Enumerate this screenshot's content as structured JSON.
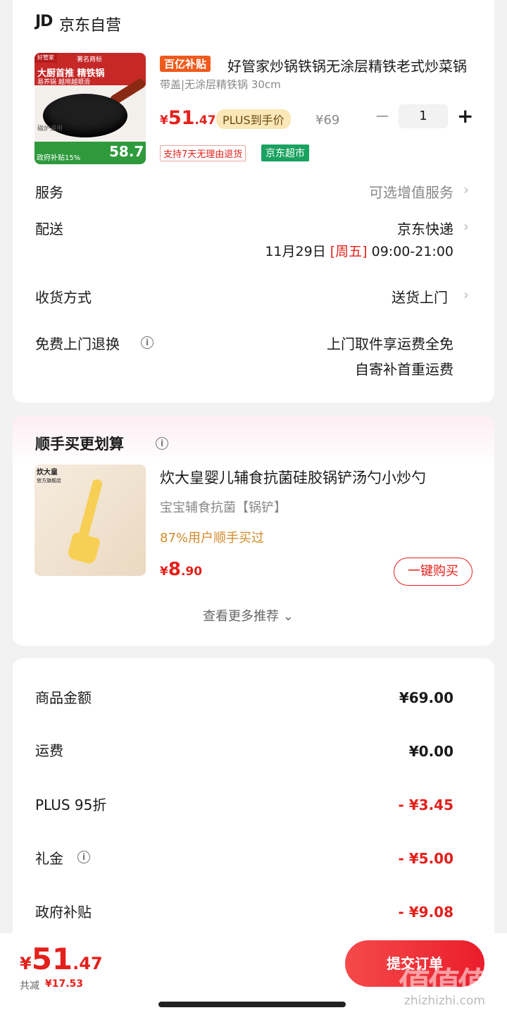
{
  "shop": {
    "logo": "JD",
    "name": "京东自营"
  },
  "product": {
    "badge": "百亿补贴",
    "title": "好管家炒锅铁锅无涂层精铁老式炒菜锅",
    "spec": "带盖|无涂层精铁锅 30cm",
    "price_symbol": "¥",
    "price_int": "51",
    "price_dec": ".47",
    "plus_tag": "PLUS到手价",
    "original_price": "¥69",
    "quantity": "1",
    "return_tag": "支持7天无理由退货",
    "supermarket_tag": "京东超市",
    "image": {
      "brand": "好管家",
      "trademark": "著名商标",
      "banner": "大厨首推 精铁锅",
      "tagline": "易养锅 越用越顺滑",
      "stove": "磁炉通用",
      "gov_subsidy": "政府补贴15%",
      "price": "58.7"
    }
  },
  "rows": {
    "service": {
      "label": "服务",
      "value": "可选增值服务"
    },
    "delivery": {
      "label": "配送",
      "value": "京东快递",
      "date": "11月29日",
      "weekday": "[周五]",
      "time": "09:00-21:00"
    },
    "receive": {
      "label": "收货方式",
      "value": "送货上门"
    },
    "return": {
      "label": "免费上门退换",
      "line1": "上门取件享运费全免",
      "line2": "自寄补首重运费"
    }
  },
  "recommend": {
    "title": "顺手买更划算",
    "item_name": "炊大皇婴儿辅食抗菌硅胶锅铲汤勺小炒勺",
    "item_sub": "宝宝辅食抗菌【锅铲】",
    "item_stat": "87%用户顺手买过",
    "price_symbol": "¥",
    "price_int": "8",
    "price_dec": ".90",
    "buy_button": "一键购买",
    "more": "查看更多推荐",
    "image_brand": "炊大皇",
    "image_store": "官方旗舰店"
  },
  "fees": [
    {
      "label": "商品金额",
      "value": "¥69.00",
      "negative": false
    },
    {
      "label": "运费",
      "value": "¥0.00",
      "negative": false
    },
    {
      "label": "PLUS 95折",
      "value": "- ¥3.45",
      "negative": true
    },
    {
      "label": "礼金",
      "value": "- ¥5.00",
      "negative": true
    },
    {
      "label": "政府补贴",
      "value": "- ¥9.08",
      "negative": true
    }
  ],
  "bottom": {
    "price_symbol": "¥",
    "price_int": "51",
    "price_dec": ".47",
    "saved_label": "共减",
    "saved_value": "¥17.53",
    "submit": "提交订单",
    "watermark": "值值值",
    "watermark_site": "zhizhizhi.com"
  },
  "icons": {
    "info": "i",
    "chevron": "›",
    "minus": "−",
    "plus": "+",
    "chevron_down": "⌄"
  },
  "colors": {
    "accent": "#e4201b",
    "green": "#1aa260",
    "plus_gold": "#fbe7b7"
  }
}
